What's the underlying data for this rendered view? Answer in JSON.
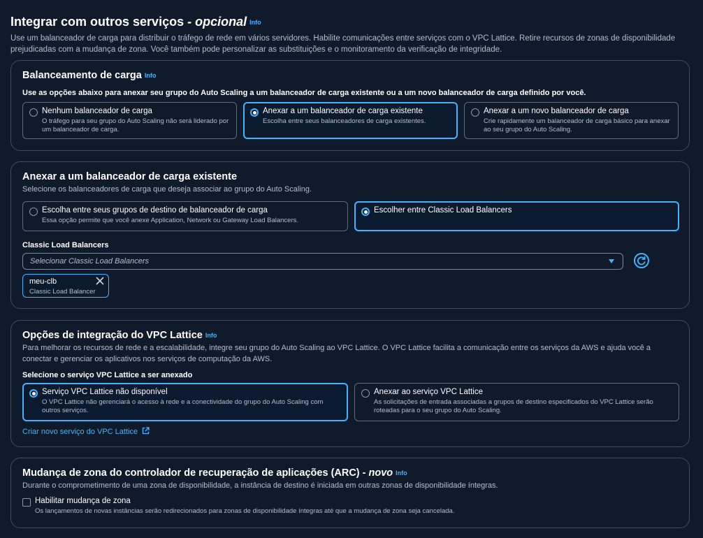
{
  "header": {
    "title": "Integrar com outros serviços - ",
    "title_optional": "opcional",
    "info": "Info",
    "description": "Use um balanceador de carga para distribuir o tráfego de rede em vários servidores. Habilite comunicações entre serviços com o VPC Lattice. Retire recursos de zonas de disponibilidade prejudicadas com a mudança de zona. Você também pode personalizar as substituições e o monitoramento da verificação de integridade."
  },
  "load_balancing": {
    "title": "Balanceamento de carga",
    "info": "Info",
    "instruction": "Use as opções abaixo para anexar seu grupo do Auto Scaling a um balanceador de carga existente ou a um novo balanceador de carga definido por você.",
    "options": [
      {
        "title": "Nenhum balanceador de carga",
        "description": "O tráfego para seu grupo do Auto Scaling não será liderado por um balanceador de carga."
      },
      {
        "title": "Anexar a um balanceador de carga existente",
        "description": "Escolha entre seus balanceadores de carga existentes."
      },
      {
        "title": "Anexar a um novo balanceador de carga",
        "description": "Crie rapidamente um balanceador de carga básico para anexar ao seu grupo do Auto Scaling."
      }
    ],
    "selected_index": 1
  },
  "attach_existing": {
    "title": "Anexar a um balanceador de carga existente",
    "description": "Selecione os balanceadores de carga que deseja associar ao grupo do Auto Scaling.",
    "options": [
      {
        "title": "Escolha entre seus grupos de destino de balanceador de carga",
        "description": "Essa opção permite que você anexe Application, Network ou Gateway Load Balancers."
      },
      {
        "title": "Escolher entre Classic Load Balancers",
        "description": ""
      }
    ],
    "selected_index": 1,
    "field_label": "Classic Load Balancers",
    "select_placeholder": "Selecionar Classic Load Balancers",
    "token": {
      "name": "meu-clb",
      "type": "Classic Load Balancer"
    }
  },
  "vpc_lattice": {
    "title": "Opções de integração do VPC Lattice",
    "info": "Info",
    "description": "Para melhorar os recursos de rede e a escalabilidade, integre seu grupo do Auto Scaling ao VPC Lattice. O VPC Lattice facilita a comunicação entre os serviços da AWS e ajuda você a conectar e gerenciar os aplicativos nos serviços de computação da AWS.",
    "select_label": "Selecione o serviço VPC Lattice a ser anexado",
    "options": [
      {
        "title": "Serviço VPC Lattice não disponível",
        "description": "O VPC Lattice não gerenciará o acesso à rede e a conectividade do grupo do Auto Scaling com outros serviços."
      },
      {
        "title": "Anexar ao serviço VPC Lattice",
        "description": "As solicitações de entrada associadas a grupos de destino especificados do VPC Lattice serão roteadas para o seu grupo do Auto Scaling."
      }
    ],
    "selected_index": 0,
    "create_link": "Criar novo serviço do VPC Lattice"
  },
  "zonal_shift": {
    "title": "Mudança de zona do controlador de recuperação de aplicações (ARC) - ",
    "title_new": "novo",
    "info": "Info",
    "description": "Durante o comprometimento de uma zona de disponibilidade, a instância de destino é iniciada em outras zonas de disponibilidade íntegras.",
    "checkbox_label": "Habilitar mudança de zona",
    "checkbox_description": "Os lançamentos de novas instâncias serão redirecionados para zonas de disponibilidade íntegras até que a mudança de zona seja cancelada.",
    "checked": false
  },
  "colors": {
    "accent": "#42b4ff",
    "background": "#0f1b2a",
    "border": "#414d5c"
  }
}
